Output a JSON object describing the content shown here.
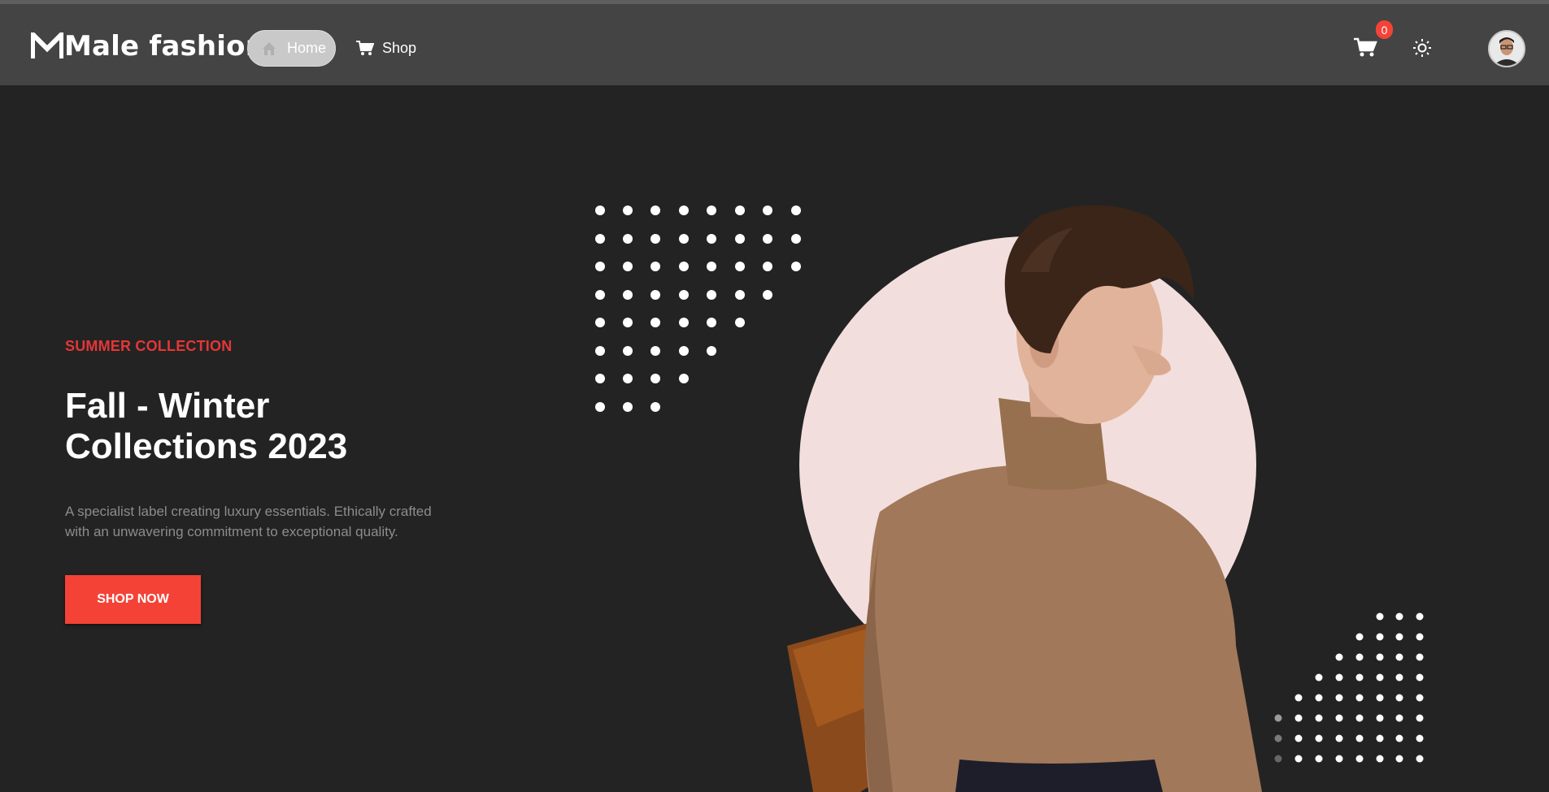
{
  "brand": {
    "name": "Male fashion",
    "accent": "#e53637"
  },
  "nav": {
    "items": [
      {
        "label": "Home",
        "icon": "home-icon",
        "active": true
      },
      {
        "label": "Shop",
        "icon": "cart-icon",
        "active": false
      }
    ]
  },
  "header": {
    "cart_icon": "cart-icon",
    "cart_count": "0",
    "theme_icon": "sun-icon",
    "avatar_icon": "user-avatar"
  },
  "hero": {
    "eyebrow": "SUMMER COLLECTION",
    "title_line1": "Fall - Winter",
    "title_line2": "Collections 2023",
    "description_line1": "A specialist label creating luxury essentials. Ethically crafted",
    "description_line2": "with an unwavering commitment to exceptional quality.",
    "cta_label": "SHOP NOW",
    "cta_color": "#f44336",
    "image_alt": "model-in-turtleneck"
  },
  "colors": {
    "navbar": "#444444",
    "background": "#232323",
    "circle": "#f2dfdd"
  }
}
